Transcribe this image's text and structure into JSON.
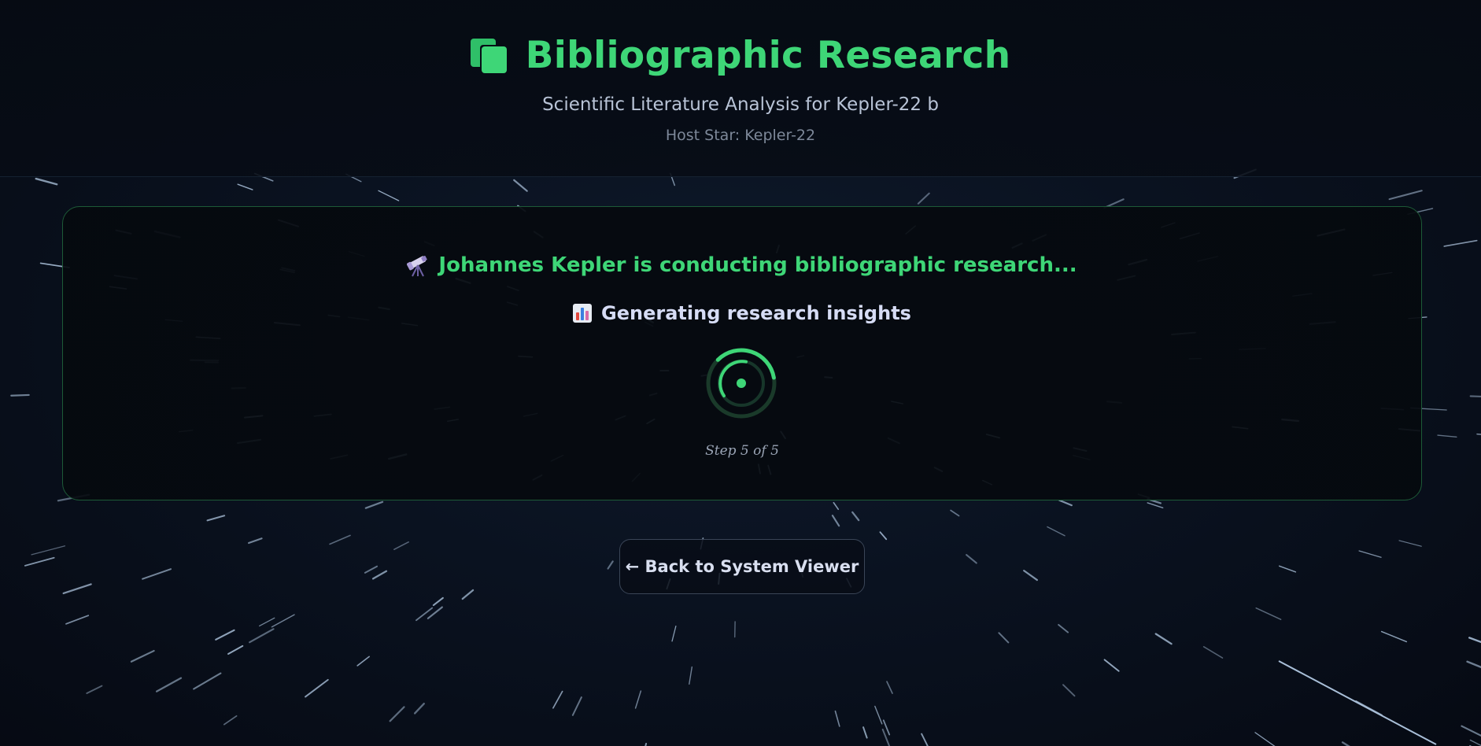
{
  "header": {
    "icon": "books-icon",
    "title": "Bibliographic Research",
    "subtitle": "Scientific Literature Analysis for Kepler-22 b",
    "host_star": "Host Star: Kepler-22"
  },
  "status": {
    "main_icon": "telescope-icon",
    "main_text": "Johannes Kepler is conducting bibliographic research...",
    "sub_icon": "bar-chart-icon",
    "sub_text": "Generating research insights",
    "step_text": "Step 5 of 5",
    "step_current": 5,
    "step_total": 5
  },
  "back_button": {
    "label": "← Back to System Viewer"
  },
  "colors": {
    "accent": "#3ed677",
    "background": "#070c16",
    "panel_border": "#1d5a37",
    "text_primary": "#d6dcf5",
    "text_muted": "#7d8899"
  }
}
